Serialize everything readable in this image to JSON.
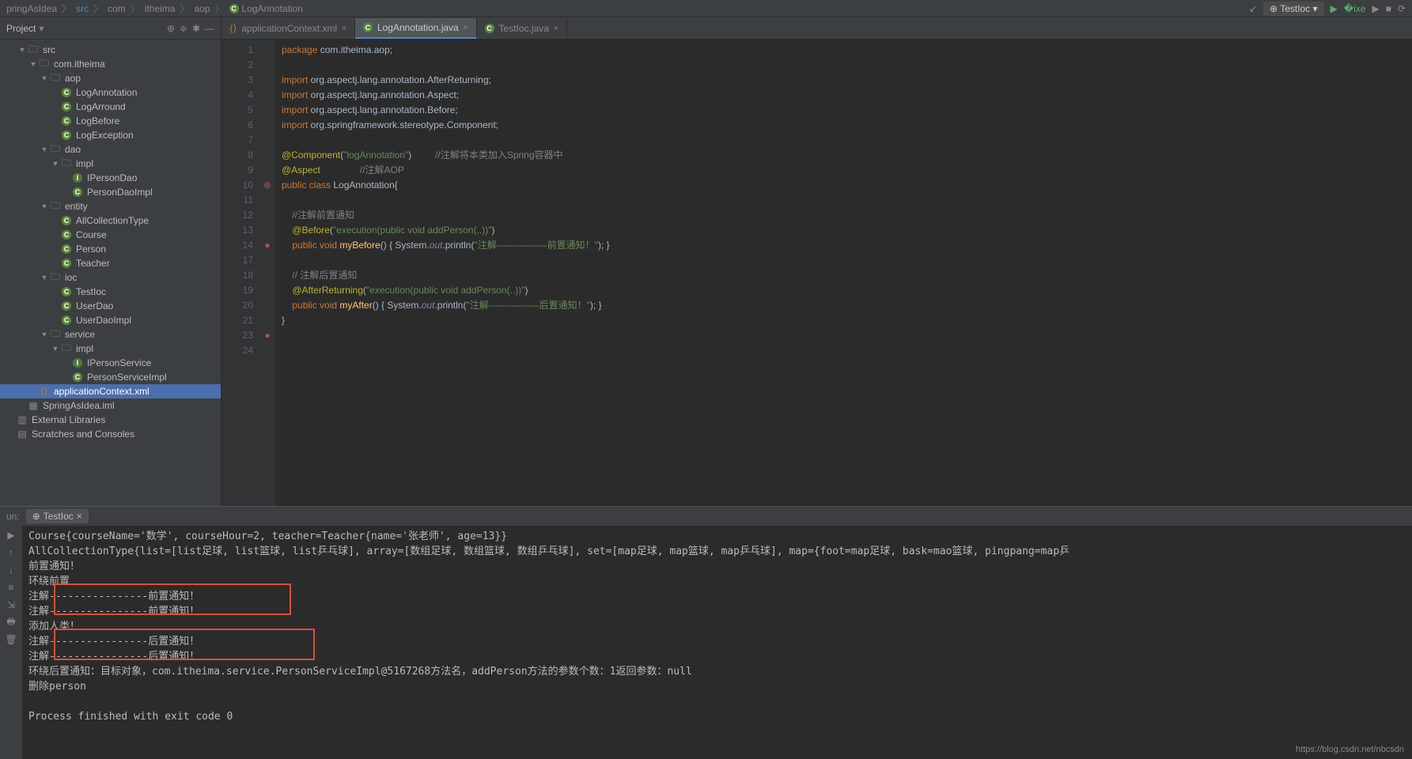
{
  "breadcrumb": [
    "pringAsIdea",
    "src",
    "com",
    "itheima",
    "aop",
    "LogAnnotation"
  ],
  "runConfig": "TestIoc",
  "projectPanel": {
    "title": "Project"
  },
  "tree": [
    {
      "d": 0,
      "a": "▼",
      "i": "folder",
      "t": "src"
    },
    {
      "d": 1,
      "a": "▼",
      "i": "package",
      "t": "com.itheima"
    },
    {
      "d": 2,
      "a": "▼",
      "i": "package",
      "t": "aop"
    },
    {
      "d": 3,
      "a": "",
      "i": "class",
      "t": "LogAnnotation"
    },
    {
      "d": 3,
      "a": "",
      "i": "class",
      "t": "LogArround"
    },
    {
      "d": 3,
      "a": "",
      "i": "class",
      "t": "LogBefore"
    },
    {
      "d": 3,
      "a": "",
      "i": "class",
      "t": "LogException"
    },
    {
      "d": 2,
      "a": "▼",
      "i": "package",
      "t": "dao"
    },
    {
      "d": 3,
      "a": "▼",
      "i": "package",
      "t": "impl"
    },
    {
      "d": 4,
      "a": "",
      "i": "interface",
      "t": "IPersonDao"
    },
    {
      "d": 4,
      "a": "",
      "i": "class",
      "t": "PersonDaoImpl"
    },
    {
      "d": 2,
      "a": "▼",
      "i": "package",
      "t": "entity"
    },
    {
      "d": 3,
      "a": "",
      "i": "class",
      "t": "AllCollectionType"
    },
    {
      "d": 3,
      "a": "",
      "i": "class",
      "t": "Course"
    },
    {
      "d": 3,
      "a": "",
      "i": "class",
      "t": "Person"
    },
    {
      "d": 3,
      "a": "",
      "i": "class",
      "t": "Teacher"
    },
    {
      "d": 2,
      "a": "▼",
      "i": "package",
      "t": "ioc"
    },
    {
      "d": 3,
      "a": "",
      "i": "class",
      "t": "TestIoc"
    },
    {
      "d": 3,
      "a": "",
      "i": "class",
      "t": "UserDao"
    },
    {
      "d": 3,
      "a": "",
      "i": "class",
      "t": "UserDaoImpl"
    },
    {
      "d": 2,
      "a": "▼",
      "i": "package",
      "t": "service"
    },
    {
      "d": 3,
      "a": "▼",
      "i": "package",
      "t": "impl"
    },
    {
      "d": 4,
      "a": "",
      "i": "interface",
      "t": "IPersonService"
    },
    {
      "d": 4,
      "a": "",
      "i": "class",
      "t": "PersonServiceImpl"
    },
    {
      "d": 1,
      "a": "",
      "i": "xml",
      "t": "applicationContext.xml",
      "sel": true
    },
    {
      "d": 0,
      "a": "",
      "i": "file",
      "t": "SpringAsIdea.iml"
    },
    {
      "d": -1,
      "a": "",
      "i": "lib",
      "t": "External Libraries"
    },
    {
      "d": -1,
      "a": "",
      "i": "scratch",
      "t": "Scratches and Consoles"
    }
  ],
  "tabs": [
    {
      "label": "applicationContext.xml",
      "icon": "xml"
    },
    {
      "label": "LogAnnotation.java",
      "icon": "class",
      "active": true
    },
    {
      "label": "TestIoc.java",
      "icon": "class"
    }
  ],
  "lineNumbers": [
    1,
    2,
    3,
    4,
    5,
    6,
    7,
    8,
    9,
    10,
    11,
    12,
    13,
    14,
    17,
    18,
    19,
    20,
    21,
    23,
    24
  ],
  "gutterIcons": {
    "13": "●",
    "19": "●",
    "9": "⊕"
  },
  "code": [
    {
      "t": "pkg",
      "raw": "<span class='kw'>package</span> com.itheima.aop;"
    },
    {
      "raw": ""
    },
    {
      "raw": "<span class='kw'>import</span> org.aspectj.lang.annotation.AfterReturning;"
    },
    {
      "raw": "<span class='kw'>import</span> org.aspectj.lang.annotation.Aspect;"
    },
    {
      "raw": "<span class='kw'>import</span> org.aspectj.lang.annotation.Before;"
    },
    {
      "raw": "<span class='kw'>import</span> org.springframework.stereotype.Component;"
    },
    {
      "raw": ""
    },
    {
      "raw": "<span class='ann'>@Component</span>(<span class='str'>\"logAnnotation\"</span>)         <span class='cmt'>//注解将本类加入Spring容器中</span>"
    },
    {
      "raw": "<span class='ann'>@Aspect</span>               <span class='cmt'>//注解AOP</span>"
    },
    {
      "raw": "<span class='kw'>public class</span> <span class='cls'>LogAnnotation</span>{"
    },
    {
      "raw": ""
    },
    {
      "raw": "    <span class='cmt'>//注解前置通知</span>"
    },
    {
      "raw": "    <span class='ann'>@Before</span>(<span class='str'>\"execution(public void addPerson(..))\"</span>)"
    },
    {
      "raw": "    <span class='kw'>public void</span> <span class='id'>myBefore</span>() { System.<span class='static'>out</span>.println(<span class='str'>\"注解----------------前置通知！\"</span>); }"
    },
    {
      "raw": ""
    },
    {
      "raw": "    <span class='cmt'>// 注解后置通知</span>"
    },
    {
      "raw": "    <span class='ann'>@AfterReturning</span>(<span class='str'>\"execution(public void addPerson(..))\"</span>)"
    },
    {
      "raw": "    <span class='kw'>public void</span> <span class='id'>myAfter</span>() { System.<span class='static'>out</span>.println(<span class='str'>\"注解----------------后置通知！\"</span>); }"
    },
    {
      "raw": "}"
    },
    {
      "raw": ""
    },
    {
      "raw": ""
    }
  ],
  "run": {
    "label": "un:",
    "tab": "TestIoc",
    "lines": [
      "Course{courseName='数学', courseHour=2, teacher=Teacher{name='张老师', age=13}}",
      "AllCollectionType{list=[list足球, list篮球, list乒乓球], array=[数组足球, 数组篮球, 数组乒乓球], set=[map足球, map篮球, map乒乓球], map={foot=map足球, bask=mao篮球, pingpang=map乒",
      "前置通知！",
      "环绕前置",
      "注解----------------前置通知！",
      "注解----------------前置通知！",
      "添加人类！",
      "注解----------------后置通知！",
      "注解----------------后置通知！",
      "环绕后置通知：目标对象，com.itheima.service.PersonServiceImpl@5167268方法名，addPerson方法的参数个数：1返回参数：null",
      "删除person",
      "",
      "Process finished with exit code 0"
    ]
  },
  "footer": "https://blog.csdn.net/nbcsdn"
}
